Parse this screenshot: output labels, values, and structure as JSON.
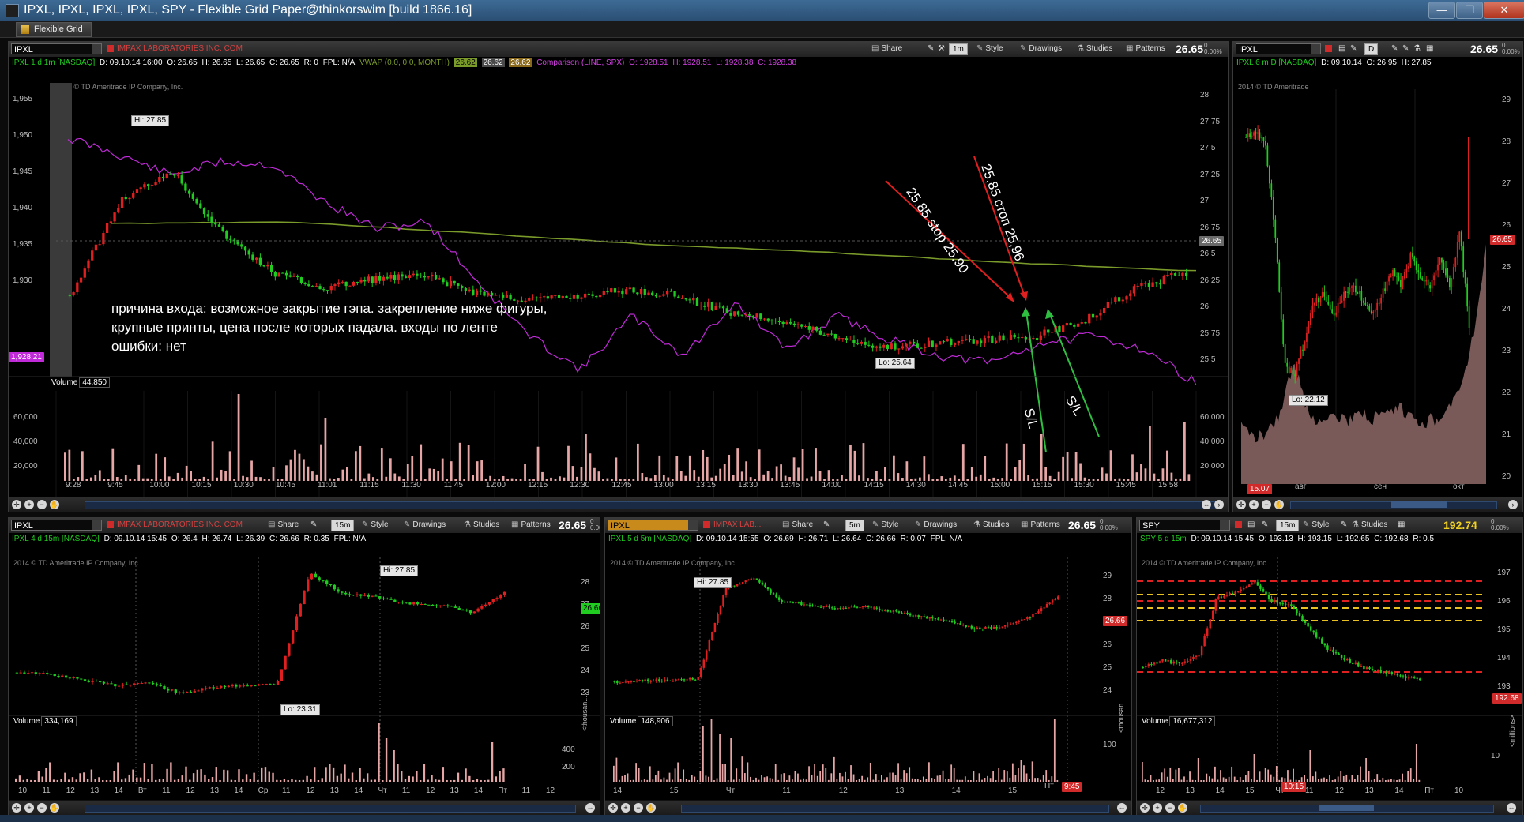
{
  "window": {
    "title": "IPXL, IPXL, IPXL, IPXL, SPY - Flexible Grid Paper@thinkorswim [build 1866.16]",
    "tab_label": "Flexible Grid",
    "controls": {
      "minimize": "—",
      "maximize": "❐",
      "close": "✕"
    }
  },
  "toolbar_labels": {
    "share": "Share",
    "style": "Style",
    "drawings": "Drawings",
    "studies": "Studies",
    "patterns": "Patterns"
  },
  "copyright": {
    "main": "2014 © TD Ameritrade IP Company, Inc.",
    "right": "2014 © TD Ameritrade",
    "bottom": "2014 © TD Ameritrade IP Company, Inc."
  },
  "main_chart": {
    "symbol": "IPXL",
    "company": "IMPAX LABORATORIES INC. COM",
    "aggregation": "1m",
    "price": "26.65",
    "change_top": "0",
    "change_pct": "0.00%",
    "legend": {
      "title": "IPXL 1 d 1m [NASDAQ]",
      "d": "D: 09.10.14 16:00",
      "o": "O: 26.65",
      "h": "H: 26.65",
      "l": "L: 26.65",
      "c": "C: 26.65",
      "r": "R: 0",
      "fpl": "FPL: N/A",
      "vwap": "VWAP (0.0, 0.0, MONTH)",
      "vwap1": "26.62",
      "vwap2": "26.62",
      "vwap3": "26.62",
      "comparison": "Comparison (LINE, SPX)",
      "co": "O: 1928.51",
      "ch": "H: 1928.51",
      "cl": "L: 1928.38",
      "cc": "C: 1928.38"
    },
    "left_axis": [
      "1,955",
      "1,950",
      "1,945",
      "1,940",
      "1,935",
      "1,930"
    ],
    "left_tag": "1,928.21",
    "right_axis": [
      "28",
      "27.75",
      "27.5",
      "27.25",
      "27",
      "26.75",
      "26.5",
      "26.25",
      "26",
      "25.75",
      "25.5"
    ],
    "right_tag": "26.65",
    "hi_label": "Hi: 27.85",
    "lo_label": "Lo: 25.64",
    "volume_title": "Volume",
    "volume_value": "44,850",
    "volume_axis": [
      "60,000",
      "40,000",
      "20,000"
    ],
    "volume_axis_right": [
      "60,000",
      "40,000",
      "20,000"
    ],
    "time_axis": [
      "9:28",
      "9:45",
      "10:00",
      "10:15",
      "10:30",
      "10:45",
      "11:01",
      "11:15",
      "11:30",
      "11:45",
      "12:00",
      "12:15",
      "12:30",
      "12:45",
      "13:00",
      "13:15",
      "13:30",
      "13:45",
      "14:00",
      "14:15",
      "14:30",
      "14:45",
      "15:00",
      "15:15",
      "15:30",
      "15:45",
      "15:58"
    ],
    "annotation_lines": [
      "причина входа: возможное закрытие гэпа. закрепление ниже фигуры,",
      "крупные принты, цена после которых падала. входы по ленте",
      "ошибки: нет"
    ],
    "arrow_label_1": "25.85 stop 25.90",
    "arrow_label_2": "25,85 стоп 25,96",
    "sl_label_1": "S/L",
    "sl_label_2": "S/L"
  },
  "right_chart": {
    "symbol": "IPXL",
    "aggregation": "D",
    "price": "26.65",
    "change_top": "0",
    "change_pct": "0.00%",
    "legend": {
      "title": "IPXL 6 m D [NASDAQ]",
      "d": "D: 09.10.14",
      "o": "O: 26.95",
      "h": "H: 27.85"
    },
    "price_axis": [
      "29",
      "28",
      "27",
      "26",
      "25",
      "24",
      "23",
      "22",
      "21",
      "20"
    ],
    "price_tag": "26.65",
    "lo_label": "Lo: 22.12",
    "vol_tag": "15.07",
    "time_axis": [
      "авг",
      "сен",
      "окт"
    ]
  },
  "bl_chart": {
    "symbol": "IPXL",
    "company": "IMPAX LABORATORIES INC. COM",
    "aggregation": "15m",
    "price": "26.65",
    "change_top": "0",
    "change_pct": "0.00%",
    "legend": {
      "title": "IPXL 4 d 15m [NASDAQ]",
      "d": "D: 09.10.14 15:45",
      "o": "O: 26.4",
      "h": "H: 26.74",
      "l": "L: 26.39",
      "c": "C: 26.66",
      "r": "R: 0.35",
      "fpl": "FPL: N/A"
    },
    "price_axis": [
      "28",
      "27",
      "26",
      "25",
      "24",
      "23"
    ],
    "price_tag": "26.66",
    "hi_label": "Hi: 27.85",
    "lo_label": "Lo: 23.31",
    "volume_title": "Volume",
    "volume_value": "334,169",
    "volume_axis": [
      "400",
      "200"
    ],
    "volume_unit": "<thousan...",
    "time_axis": [
      "10",
      "11",
      "12",
      "13",
      "14",
      "Вт",
      "11",
      "12",
      "13",
      "14",
      "Ср",
      "11",
      "12",
      "13",
      "14",
      "Чт",
      "11",
      "12",
      "13",
      "14",
      "Пт",
      "11",
      "12"
    ]
  },
  "bm_chart": {
    "symbol": "IPXL",
    "company": "IMPAX LAB...",
    "aggregation": "5m",
    "price": "26.65",
    "change_top": "0",
    "change_pct": "0.00%",
    "legend": {
      "title": "IPXL 5 d 5m [NASDAQ]",
      "d": "D: 09.10.14 15:55",
      "o": "O: 26.69",
      "h": "H: 26.71",
      "l": "L: 26.64",
      "c": "C: 26.66",
      "r": "R: 0.07",
      "fpl": "FPL: N/A"
    },
    "price_axis": [
      "29",
      "28",
      "27",
      "26",
      "25",
      "24"
    ],
    "price_tag": "26.66",
    "hi_label": "Hi: 27.85",
    "volume_title": "Volume",
    "volume_value": "148,906",
    "volume_axis": [
      "100"
    ],
    "volume_unit": "<thousan...",
    "time_axis": [
      "14",
      "15",
      "Чт",
      "11",
      "12",
      "13",
      "14",
      "15"
    ],
    "time_tag_left": "Пт",
    "time_tag": "9:45"
  },
  "br_chart": {
    "symbol": "SPY",
    "aggregation": "15m",
    "price": "192.74",
    "change_top": "0",
    "change_pct": "0.00%",
    "legend": {
      "title": "SPY 5 d 15m",
      "d": "D: 09.10.14 15:45",
      "o": "O: 193.13",
      "h": "H: 193.15",
      "l": "L: 192.65",
      "c": "C: 192.68",
      "r": "R: 0.5"
    },
    "price_axis": [
      "197",
      "196",
      "195",
      "194",
      "193"
    ],
    "price_tag": "192.68",
    "volume_title": "Volume",
    "volume_value": "16,677,312",
    "volume_axis": [
      "10"
    ],
    "volume_unit": "<millions>",
    "time_axis": [
      "12",
      "13",
      "14",
      "15",
      "Чт",
      "11",
      "12",
      "13",
      "14",
      "Пт",
      "10"
    ],
    "time_tag": "10:15"
  },
  "colors": {
    "up": "#1fcc1f",
    "down": "#e02020",
    "vwap": "#7a9a2a",
    "comparison": "#c02ad8",
    "volume": "#e7a6a6",
    "support_red": "#e02020",
    "support_yellow": "#e8c020"
  }
}
